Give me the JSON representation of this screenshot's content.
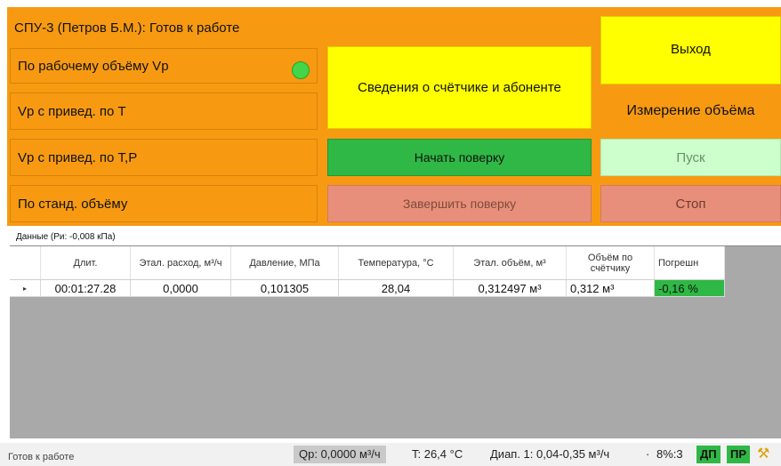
{
  "header": {
    "title": "СПУ-3 (Петров Б.М.): Готов к работе"
  },
  "volume_modes": [
    {
      "label": "По рабочему объёму Vp",
      "active": true
    },
    {
      "label": "Vp с привед. по T",
      "active": false
    },
    {
      "label": "Vp с привед. по T,P",
      "active": false
    },
    {
      "label": "По станд. объёму",
      "active": false
    }
  ],
  "actions": {
    "info_label": "Сведения о счётчике и абоненте",
    "start_check_label": "Начать поверку",
    "finish_check_label": "Завершить поверку",
    "exit_label": "Выход",
    "measure_title": "Измерение объёма",
    "start_label": "Пуск",
    "stop_label": "Стоп"
  },
  "grid": {
    "caption": "Данные (Ри: -0,008 кПа)",
    "columns": [
      "Длит.",
      "Этал. расход, м³/ч",
      "Давление, МПа",
      "Температура, °C",
      "Этал. объём, м³",
      "Объём по счётчику",
      "Погрешн"
    ],
    "rows": [
      {
        "marker": "▸",
        "duration": "00:01:27.28",
        "flow": "0,0000",
        "pressure": "0,101305",
        "temperature": "28,04",
        "ref_volume": "0,312497 м³",
        "meter_volume": "0,312 м³",
        "error": "-0,16 %"
      }
    ]
  },
  "status": {
    "text": "Готов к работе",
    "flow": "Qр: 0,0000 м³/ч",
    "temperature": "T: 26,4 °C",
    "range": "Диап. 1: 0,04-0,35 м³/ч",
    "sep": "·",
    "ratio": "8%:3",
    "dp": "ДП",
    "pr": "ПР"
  },
  "colors": {
    "orange": "#f79a12",
    "yellow": "#ffff00",
    "green": "#2fb845",
    "salmon": "#e88f7b",
    "light_green": "#ccffcc",
    "lamp_green": "#43d648"
  },
  "icons": {
    "lamp": "status-lamp-icon",
    "tools": "tools-icon",
    "row_marker": "row-pointer-icon"
  }
}
